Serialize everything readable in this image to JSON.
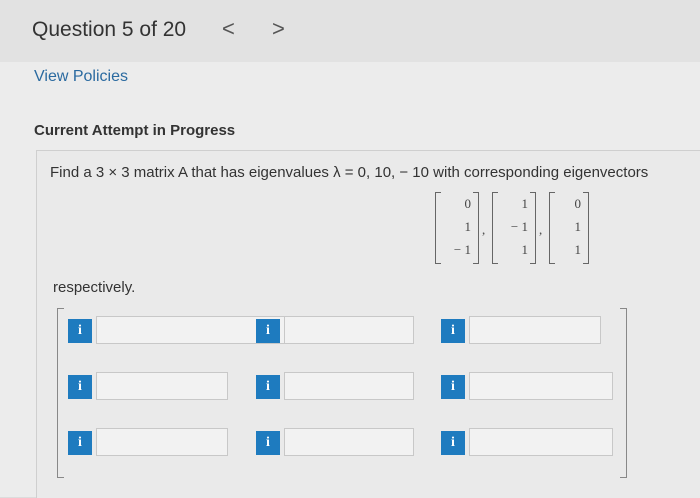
{
  "header": {
    "question_label": "Question 5 of 20",
    "prev_arrow": "<",
    "next_arrow": ">"
  },
  "links": {
    "view_policies": "View Policies"
  },
  "attempt_heading": "Current Attempt in Progress",
  "question": {
    "prompt": "Find a 3 × 3 matrix A that has eigenvalues λ = 0, 10, − 10 with corresponding eigenvectors",
    "eigenvectors": [
      [
        "0",
        "1",
        "− 1"
      ],
      [
        "1",
        "− 1",
        "1"
      ],
      [
        "0",
        "1",
        "1"
      ]
    ],
    "separator": ",",
    "suffix": "respectively."
  },
  "answer_grid": {
    "info_icon_glyph": "i",
    "rows": [
      [
        "",
        "",
        ""
      ],
      [
        "",
        "",
        ""
      ],
      [
        "",
        "",
        ""
      ]
    ]
  },
  "colors": {
    "info_icon": "#1e7bbf",
    "link": "#2a6aa0"
  }
}
